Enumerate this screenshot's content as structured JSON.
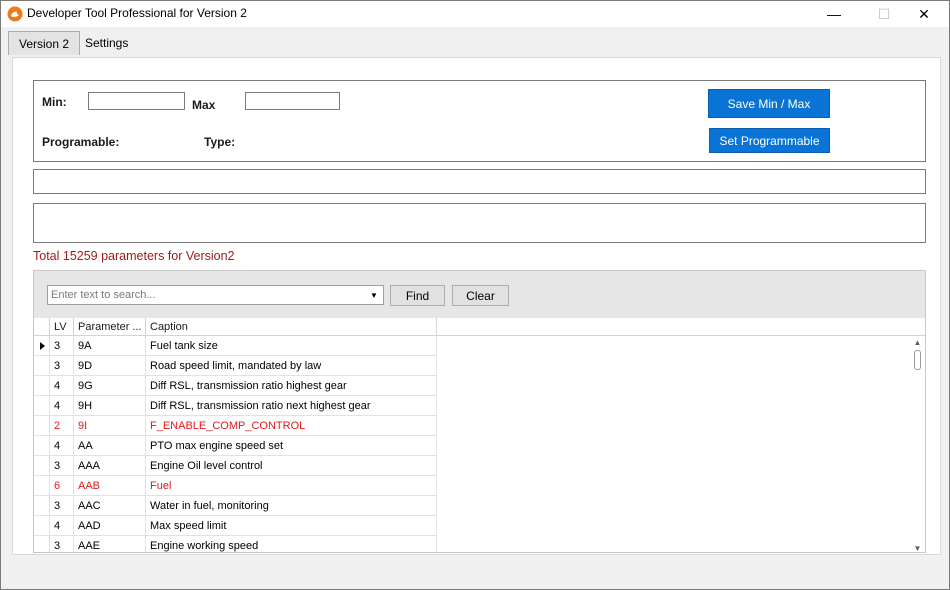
{
  "window": {
    "title": "Developer Tool Professional for Version 2",
    "app_icon": "orange-app-icon",
    "controls": {
      "minimize": "—",
      "maximize": "☐",
      "close": "✕"
    }
  },
  "tabs": [
    {
      "label": "Version 2",
      "active": true
    },
    {
      "label": "Settings",
      "active": false
    }
  ],
  "form": {
    "min_label": "Min:",
    "min_value": "",
    "max_label": "Max",
    "max_value": "",
    "programable_label": "Programable:",
    "type_label": "Type:",
    "save_button": "Save Min / Max",
    "set_programmable_button": "Set Programmable"
  },
  "total_text": "Total 15259 parameters for Version2",
  "search": {
    "placeholder": "Enter text to search...",
    "value": "",
    "find_button": "Find",
    "clear_button": "Clear"
  },
  "grid": {
    "columns": [
      "LV",
      "Parameter ...",
      "Caption"
    ],
    "rows": [
      {
        "lv": "3",
        "param": "9A",
        "caption": "Fuel tank size",
        "selected": true,
        "warn": false
      },
      {
        "lv": "3",
        "param": "9D",
        "caption": "Road speed limit, mandated by law",
        "selected": false,
        "warn": false
      },
      {
        "lv": "4",
        "param": "9G",
        "caption": "Diff RSL, transmission ratio highest gear",
        "selected": false,
        "warn": false
      },
      {
        "lv": "4",
        "param": "9H",
        "caption": "Diff RSL, transmission ratio next highest gear",
        "selected": false,
        "warn": false
      },
      {
        "lv": "2",
        "param": "9I",
        "caption": "F_ENABLE_COMP_CONTROL",
        "selected": false,
        "warn": true
      },
      {
        "lv": "4",
        "param": "AA",
        "caption": "PTO max engine speed set",
        "selected": false,
        "warn": false
      },
      {
        "lv": "3",
        "param": "AAA",
        "caption": "Engine Oil level control",
        "selected": false,
        "warn": false
      },
      {
        "lv": "6",
        "param": "AAB",
        "caption": "Fuel",
        "selected": false,
        "warn": true
      },
      {
        "lv": "3",
        "param": "AAC",
        "caption": "Water in fuel, monitoring",
        "selected": false,
        "warn": false
      },
      {
        "lv": "4",
        "param": "AAD",
        "caption": "Max speed limit",
        "selected": false,
        "warn": false
      },
      {
        "lv": "3",
        "param": "AAE",
        "caption": "Engine working speed",
        "selected": false,
        "warn": false
      }
    ]
  },
  "colors": {
    "accent_button": "#0a74d6",
    "total_text": "#9c1a1a",
    "warn_row_text": "#e01a1a"
  }
}
